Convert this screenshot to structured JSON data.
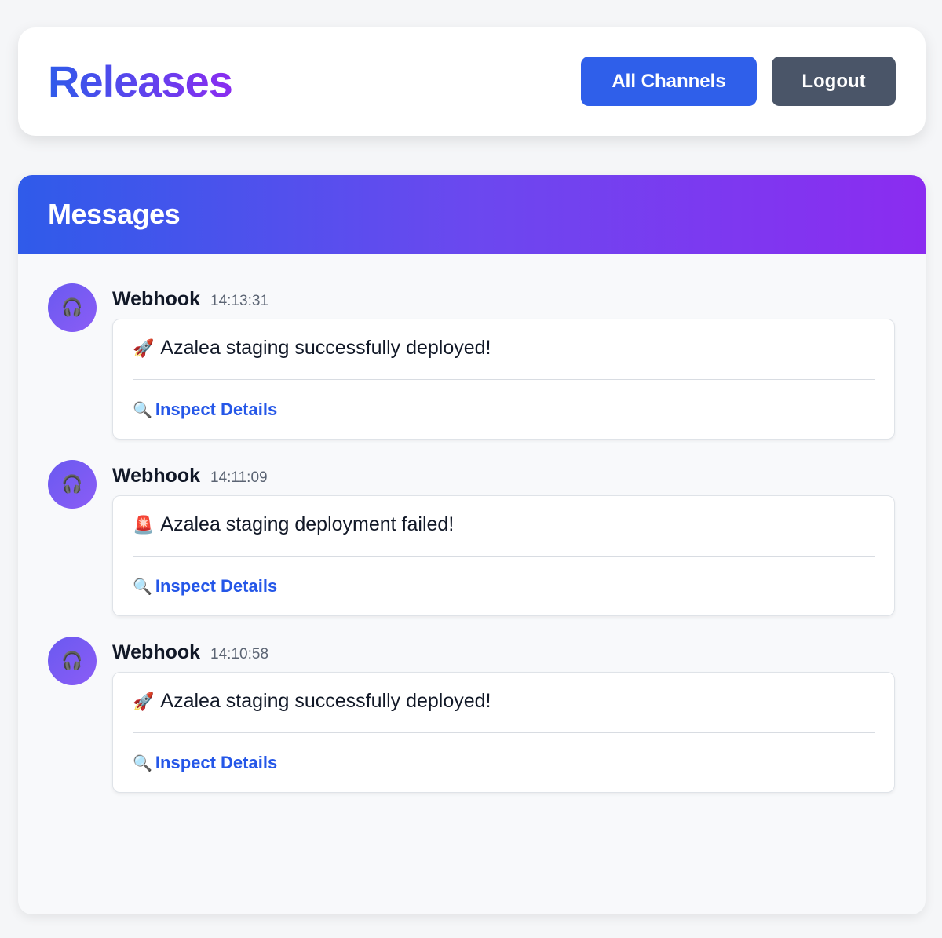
{
  "header": {
    "title": "Releases",
    "buttons": {
      "channels": "All Channels",
      "logout": "Logout"
    }
  },
  "panel": {
    "title": "Messages"
  },
  "messages": [
    {
      "author": "Webhook",
      "time": "14:13:31",
      "avatar_icon": "🎧",
      "emoji": "🚀",
      "text": "Azalea staging successfully deployed!",
      "link_icon": "🔍",
      "link_label": "Inspect Details"
    },
    {
      "author": "Webhook",
      "time": "14:11:09",
      "avatar_icon": "🎧",
      "emoji": "🚨",
      "text": "Azalea staging deployment failed!",
      "link_icon": "🔍",
      "link_label": "Inspect Details"
    },
    {
      "author": "Webhook",
      "time": "14:10:58",
      "avatar_icon": "🎧",
      "emoji": "🚀",
      "text": "Azalea staging successfully deployed!",
      "link_icon": "🔍",
      "link_label": "Inspect Details"
    }
  ],
  "colors": {
    "primary": "#2f5fea",
    "secondary": "#4a5568",
    "accent_end": "#8b2cf0",
    "link": "#2557e8"
  }
}
